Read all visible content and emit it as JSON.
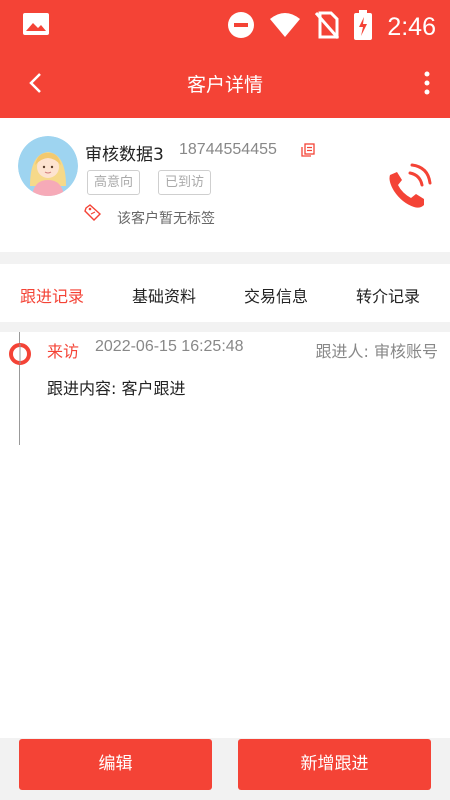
{
  "status_bar": {
    "time": "2:46",
    "icons": [
      "image-icon",
      "do-not-disturb-icon",
      "wifi-icon",
      "no-sim-icon",
      "battery-charging-icon"
    ]
  },
  "app_bar": {
    "title": "客户详情",
    "back_icon": "back-arrow-icon",
    "more_icon": "more-vertical-icon"
  },
  "customer": {
    "name": "审核数据3",
    "phone": "18744554455",
    "tags": [
      "高意向",
      "已到访"
    ],
    "no_tag_text": "该客户暂无标签",
    "copy_icon": "copy-icon",
    "call_icon": "phone-call-icon"
  },
  "tabs": [
    {
      "label": "跟进记录",
      "active": true
    },
    {
      "label": "基础资料",
      "active": false
    },
    {
      "label": "交易信息",
      "active": false
    },
    {
      "label": "转介记录",
      "active": false
    }
  ],
  "records": [
    {
      "type": "来访",
      "time": "2022-06-15 16:25:48",
      "follower": "跟进人: 审核账号",
      "content": "跟进内容: 客户跟进"
    }
  ],
  "buttons": {
    "edit": "编辑",
    "add_follow": "新增跟进"
  },
  "colors": {
    "primary": "#f44336",
    "background": "#f2f2f2"
  }
}
